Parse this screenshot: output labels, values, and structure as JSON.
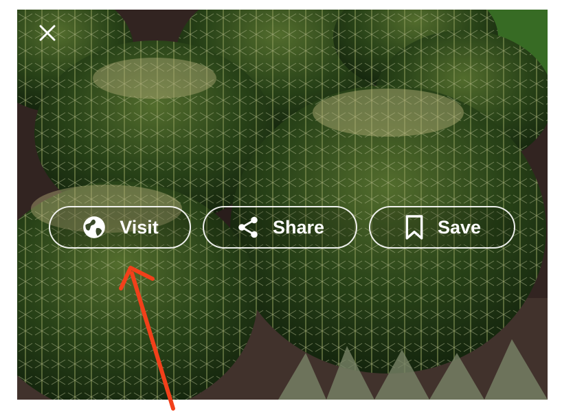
{
  "viewer": {
    "close_icon": "close-icon",
    "image_subject": "golden barrel cacti",
    "actions": [
      {
        "label": "Visit",
        "icon": "globe-icon"
      },
      {
        "label": "Share",
        "icon": "share-icon"
      },
      {
        "label": "Save",
        "icon": "bookmark-icon"
      }
    ]
  },
  "annotation": {
    "type": "arrow",
    "color": "#f2401a",
    "points_to": "Visit"
  },
  "colors": {
    "button_border": "#ffffff",
    "button_text": "#ffffff"
  }
}
